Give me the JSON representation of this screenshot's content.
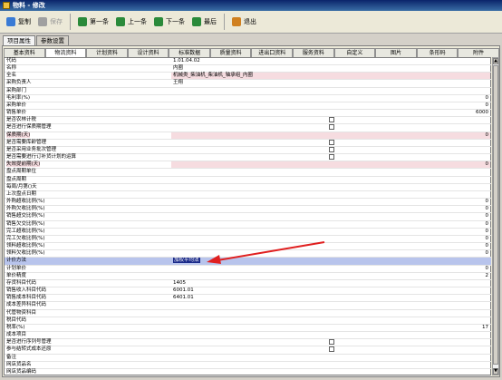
{
  "window": {
    "title": "物料 - 修改"
  },
  "toolbar": {
    "buttons": [
      {
        "label": "复制",
        "icon": "copy-icon",
        "enabled": true
      },
      {
        "label": "保存",
        "icon": "save-icon",
        "enabled": false
      },
      {
        "label": "第一条",
        "icon": "first-record-icon",
        "enabled": true
      },
      {
        "label": "上一条",
        "icon": "previous-record-icon",
        "enabled": true
      },
      {
        "label": "下一条",
        "icon": "next-record-icon",
        "enabled": true
      },
      {
        "label": "最后",
        "icon": "last-record-icon",
        "enabled": true
      },
      {
        "label": "退出",
        "icon": "exit-icon",
        "enabled": true
      }
    ]
  },
  "outer_tabs": [
    "项目属性",
    "参数设置"
  ],
  "inner_tabs": [
    "基本资料",
    "物流资料",
    "计划资料",
    "设计资料",
    "标准数据",
    "质量资料",
    "进出口资料",
    "服务资料",
    "自定义",
    "图片",
    "条形码",
    "附件"
  ],
  "active_inner_tab": 1,
  "rows": [
    {
      "label": "代码",
      "value": "1.01.04.02"
    },
    {
      "label": "名称",
      "value": "内圈"
    },
    {
      "label": "全名",
      "value": "机械类_柴油机_柴油机_轴承组_内圈",
      "pink": true
    },
    {
      "label": "采购负责人",
      "value": "王翔"
    },
    {
      "label": "采购部门",
      "value": ""
    },
    {
      "label": "毛利率(%)",
      "value": "",
      "number": "0"
    },
    {
      "label": "采购单价",
      "value": "",
      "number": "0"
    },
    {
      "label": "销售单价",
      "value": "",
      "number": "6000"
    },
    {
      "label": "是否农林计税",
      "value": "",
      "checkbox": true
    },
    {
      "label": "是否进行保质期管理",
      "value": "",
      "checkbox": true
    },
    {
      "label": "保质期(天)",
      "value": "",
      "number": "0",
      "pink": true,
      "labelpink": true
    },
    {
      "label": "是否需要库龄管理",
      "value": "",
      "checkbox": true
    },
    {
      "label": "是否采用业务批次管理",
      "value": "",
      "checkbox": true
    },
    {
      "label": "是否需要进行订补货计划的运算",
      "value": "",
      "checkbox": true
    },
    {
      "label": "失效提前期(天)",
      "value": "",
      "number": "0",
      "pink": true,
      "labelpink": true
    },
    {
      "label": "盘点周期单位",
      "value": ""
    },
    {
      "label": "盘点周期",
      "value": ""
    },
    {
      "label": "每周/月第()天",
      "value": ""
    },
    {
      "label": "上次盘点日期",
      "value": ""
    },
    {
      "label": "外购超收比例(%)",
      "value": "",
      "number": "0"
    },
    {
      "label": "外购欠收比例(%)",
      "value": "",
      "number": "0"
    },
    {
      "label": "销售超交比例(%)",
      "value": "",
      "number": "0"
    },
    {
      "label": "销售欠交比例(%)",
      "value": "",
      "number": "0"
    },
    {
      "label": "完工超收比例(%)",
      "value": "",
      "number": "0"
    },
    {
      "label": "完工欠收比例(%)",
      "value": "",
      "number": "0"
    },
    {
      "label": "领料超收比例(%)",
      "value": "",
      "number": "0"
    },
    {
      "label": "领料欠收比例(%)",
      "value": "",
      "number": "0"
    },
    {
      "label": "计价方法",
      "value": "加权平均法",
      "selected": true
    },
    {
      "label": "计划单价",
      "value": "",
      "number": "0"
    },
    {
      "label": "单价精度",
      "value": "",
      "number": "2"
    },
    {
      "label": "存货科目代码",
      "value": "1405"
    },
    {
      "label": "销售收入科目代码",
      "value": "6001.01"
    },
    {
      "label": "销售成本科目代码",
      "value": "6401.01"
    },
    {
      "label": "成本差异科目代码",
      "value": ""
    },
    {
      "label": "代管物资科目",
      "value": ""
    },
    {
      "label": "税目代码",
      "value": ""
    },
    {
      "label": "税率(%)",
      "value": "",
      "number": "17"
    },
    {
      "label": "成本项目",
      "value": ""
    },
    {
      "label": "是否进行序列号管理",
      "value": "",
      "checkbox": true
    },
    {
      "label": "参与结转式成本还原",
      "value": "",
      "checkbox": true
    },
    {
      "label": "备注",
      "value": ""
    },
    {
      "label": "网店货品名",
      "value": ""
    },
    {
      "label": "网店货品编码",
      "value": ""
    }
  ],
  "colors": {
    "selected_row": "#b8c4ec",
    "required_field": "#f6dce0",
    "annotation_arrow": "#e02020"
  }
}
